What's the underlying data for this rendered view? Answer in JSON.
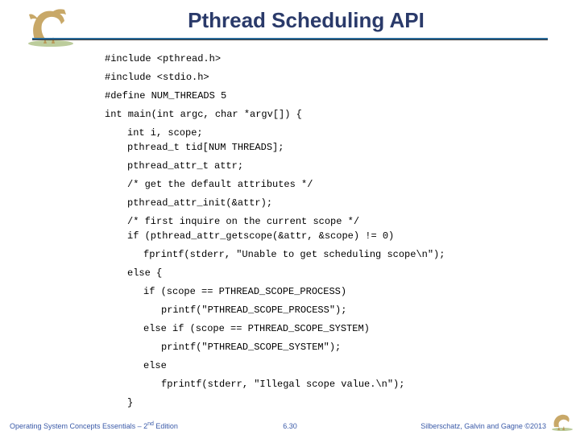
{
  "title": "Pthread Scheduling API",
  "code": {
    "l1": "#include <pthread.h>",
    "l2": "#include <stdio.h>",
    "l3": "#define NUM_THREADS 5",
    "l4": "int main(int argc, char *argv[]) {",
    "l5a": "int i, scope;",
    "l5b": "pthread_t tid[NUM THREADS];",
    "l6": "pthread_attr_t attr;",
    "l7": "/* get the default attributes */",
    "l8": "pthread_attr_init(&attr);",
    "l9a": "/* first inquire on the current scope */",
    "l9b": "if (pthread_attr_getscope(&attr, &scope) != 0)",
    "l10": "fprintf(stderr, \"Unable to get scheduling scope\\n\");",
    "l11": "else {",
    "l12": "if (scope == PTHREAD_SCOPE_PROCESS)",
    "l13": "printf(\"PTHREAD_SCOPE_PROCESS\");",
    "l14": "else if (scope == PTHREAD_SCOPE_SYSTEM)",
    "l15": "printf(\"PTHREAD_SCOPE_SYSTEM\");",
    "l16": "else",
    "l17": "fprintf(stderr, \"Illegal scope value.\\n\");",
    "l18": "}"
  },
  "footer": {
    "left_pre": "Operating System Concepts Essentials – 2",
    "left_sup": "nd",
    "left_post": " Edition",
    "center": "6.30",
    "right": "Silberschatz, Galvin and Gagne ©2013"
  }
}
